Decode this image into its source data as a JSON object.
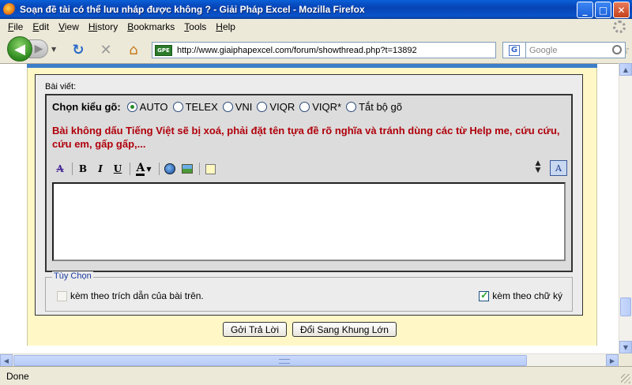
{
  "window": {
    "title": "Soạn đề tài có thể lưu nháp được không ? - Giải Pháp Excel - Mozilla Firefox",
    "minimize": "_",
    "maximize": "□",
    "close": "✕"
  },
  "menu": {
    "items": [
      {
        "key": "F",
        "rest": "ile"
      },
      {
        "key": "E",
        "rest": "dit"
      },
      {
        "key": "V",
        "rest": "iew"
      },
      {
        "key": "Hi",
        "rest": "story"
      },
      {
        "key": "B",
        "rest": "ookmarks"
      },
      {
        "key": "T",
        "rest": "ools"
      },
      {
        "key": "H",
        "rest": "elp"
      }
    ]
  },
  "nav": {
    "site_badge": "GPE",
    "url": "http://www.giaiphapexcel.com/forum/showthread.php?t=13892",
    "search_engine": "G",
    "search_placeholder": "Google"
  },
  "form": {
    "post_label": "Bài viết:",
    "typing_label": "Chọn kiểu gõ:",
    "typing_modes": [
      "AUTO",
      "TELEX",
      "VNI",
      "VIQR",
      "VIQR*",
      "Tắt bộ gõ"
    ],
    "selected_mode": "AUTO",
    "warning": "Bài không dấu Tiếng Việt sẽ bị xoá, phải đặt tên tựa đề rõ nghĩa và tránh dùng các từ Help me, cứu cứu, cứu em, gấp gấp,...",
    "toolbar": {
      "bold": "B",
      "italic": "I",
      "underline": "U",
      "font_color": "A",
      "mode_toggle": "A"
    },
    "message_value": "",
    "options_legend": "Tùy Chọn",
    "option_quote": "kèm theo trích dẫn của bài trên.",
    "option_quote_checked": false,
    "option_signature": "kèm theo chữ ký",
    "option_signature_checked": true,
    "submit_label": "Gởi Trả Lời",
    "advanced_label": "Đổi Sang Khung Lớn"
  },
  "status": {
    "text": "Done"
  }
}
